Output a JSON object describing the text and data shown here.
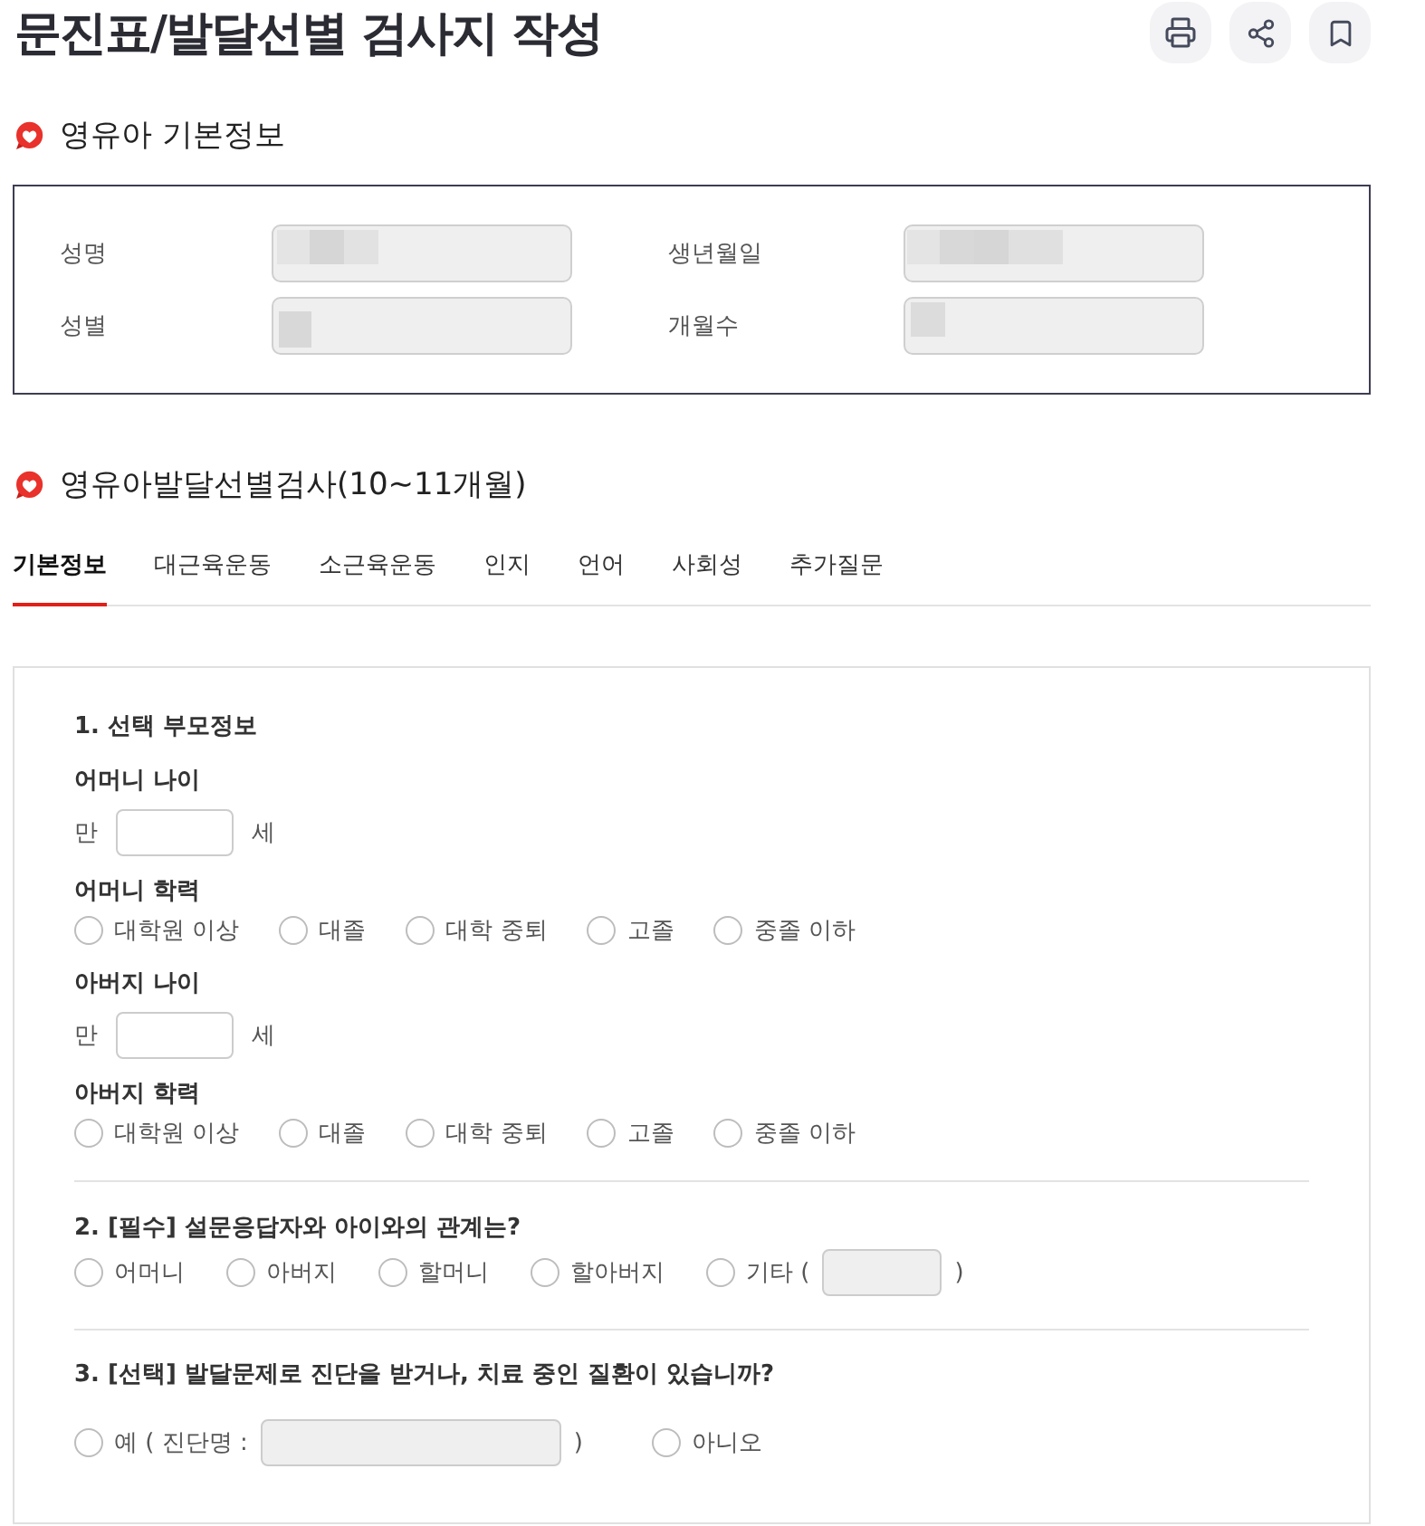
{
  "header": {
    "title": "문진표/발달선별 검사지 작성"
  },
  "child_info": {
    "heading": "영유아 기본정보",
    "fields": [
      {
        "label": "성명",
        "blurred": true
      },
      {
        "label": "생년월일",
        "blurred": true
      },
      {
        "label": "성별",
        "blurred": true
      },
      {
        "label": "개월수",
        "blurred": true
      }
    ]
  },
  "screening": {
    "heading": "영유아발달선별검사(10~11개월)",
    "tabs": [
      {
        "label": "기본정보",
        "selected": true
      },
      {
        "label": "대근육운동",
        "selected": false
      },
      {
        "label": "소근육운동",
        "selected": false
      },
      {
        "label": "인지",
        "selected": false
      },
      {
        "label": "언어",
        "selected": false
      },
      {
        "label": "사회성",
        "selected": false
      },
      {
        "label": "추가질문",
        "selected": false
      }
    ],
    "questions": [
      {
        "title": "1. 선택 부모정보",
        "items": [
          {
            "kind": "age",
            "label": "어머니 나이",
            "prefix": "만",
            "suffix": "세"
          },
          {
            "kind": "choice",
            "label": "어머니 학력",
            "options": [
              {
                "kind": "plain",
                "label": "대학원 이상",
                "selected": false
              },
              {
                "kind": "plain",
                "label": "대졸",
                "selected": false
              },
              {
                "kind": "plain",
                "label": "대학 중퇴",
                "selected": false
              },
              {
                "kind": "plain",
                "label": "고졸",
                "selected": false
              },
              {
                "kind": "plain",
                "label": "중졸 이하",
                "selected": false
              }
            ]
          },
          {
            "kind": "age",
            "label": "아버지 나이",
            "prefix": "만",
            "suffix": "세"
          },
          {
            "kind": "choice",
            "label": "아버지 학력",
            "options": [
              {
                "kind": "plain",
                "label": "대학원 이상",
                "selected": false
              },
              {
                "kind": "plain",
                "label": "대졸",
                "selected": false
              },
              {
                "kind": "plain",
                "label": "대학 중퇴",
                "selected": false
              },
              {
                "kind": "plain",
                "label": "고졸",
                "selected": false
              },
              {
                "kind": "plain",
                "label": "중졸 이하",
                "selected": false
              }
            ]
          }
        ]
      },
      {
        "title": "2. [필수] 설문응답자와 아이와의 관계는?",
        "options": [
          {
            "kind": "plain",
            "label": "어머니",
            "selected": false
          },
          {
            "kind": "plain",
            "label": "아버지",
            "selected": false
          },
          {
            "kind": "plain",
            "label": "할머니",
            "selected": false
          },
          {
            "kind": "plain",
            "label": "할아버지",
            "selected": false
          },
          {
            "kind": "with_input",
            "label": "기타 (",
            "selected": false,
            "input": {
              "disabled": true
            },
            "suffix": ")"
          }
        ]
      },
      {
        "title": "3. [선택] 발달문제로 진단을 받거나, 치료 중인 질환이 있습니까?",
        "options": [
          {
            "kind": "with_input",
            "label": "예 ( 진단명 :",
            "selected": false,
            "input": {
              "disabled": true
            },
            "suffix": ")"
          },
          {
            "kind": "plain",
            "label": "아니오",
            "selected": false
          }
        ]
      }
    ]
  }
}
